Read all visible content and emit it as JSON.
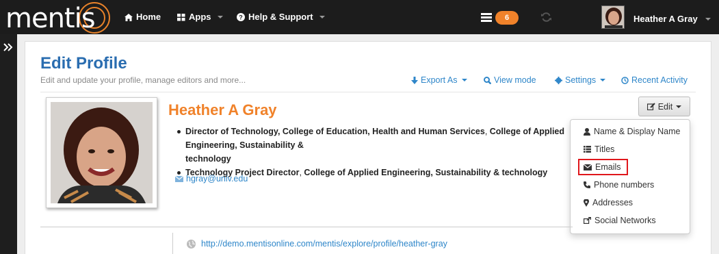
{
  "brand": {
    "logo_text": "mentis"
  },
  "nav": {
    "home_label": "Home",
    "apps_label": "Apps",
    "help_label": "Help & Support",
    "notification_count": "6",
    "user_name": "Heather A Gray"
  },
  "header": {
    "title": "Edit Profile",
    "subtitle": "Edit and update your profile, manage editors and more...",
    "actions": {
      "export": "Export As",
      "view_mode": "View mode",
      "settings": "Settings",
      "recent_activity": "Recent Activity"
    }
  },
  "profile": {
    "name": "Heather A Gray",
    "titles": [
      {
        "role": "Director of Technology, College of Education, Health and Human Services",
        "org": "College of Applied Engineering, Sustainability &",
        "continuation": "technology"
      },
      {
        "role": "Technology Project Director",
        "org": "College of Applied Engineering, Sustainability & technology"
      }
    ],
    "email": "hgray@univ.edu",
    "url": "http://demo.mentisonline.com/mentis/explore/profile/heather-gray"
  },
  "edit_menu": {
    "button_label": "Edit",
    "items": [
      {
        "label": "Name & Display Name",
        "icon": "user-icon"
      },
      {
        "label": "Titles",
        "icon": "list-icon"
      },
      {
        "label": "Emails",
        "icon": "envelope-icon",
        "highlighted": true
      },
      {
        "label": "Phone numbers",
        "icon": "phone-icon"
      },
      {
        "label": "Addresses",
        "icon": "map-marker-icon"
      },
      {
        "label": "Social Networks",
        "icon": "share-icon"
      }
    ]
  },
  "colors": {
    "accent_orange": "#f0822a",
    "link_blue": "#2e86c9",
    "title_blue": "#2a6db0",
    "highlight_red": "#e0161b"
  }
}
